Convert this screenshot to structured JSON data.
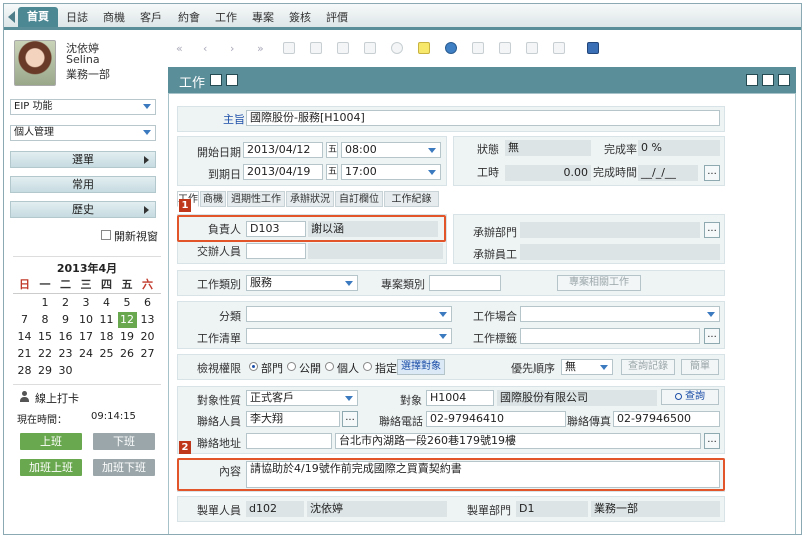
{
  "nav": {
    "tabs": [
      "首頁",
      "日誌",
      "商機",
      "客戶",
      "約會",
      "工作",
      "專案",
      "簽核",
      "評價"
    ],
    "active_index": 0
  },
  "user": {
    "name_zh": "沈依婷",
    "name_en": "Selina",
    "dept": "業務一部"
  },
  "sidebar": {
    "eip_select": "EIP 功能",
    "personal_select": "個人管理",
    "menu_items": [
      "選單",
      "常用",
      "歷史"
    ],
    "new_window_label": "開新視窗"
  },
  "calendar": {
    "title": "2013年4月",
    "weekday_headers": [
      "日",
      "一",
      "二",
      "三",
      "四",
      "五",
      "六"
    ],
    "rows": [
      [
        "",
        "1",
        "2",
        "3",
        "4",
        "5",
        "6"
      ],
      [
        "7",
        "8",
        "9",
        "10",
        "11",
        "12",
        "13"
      ],
      [
        "14",
        "15",
        "16",
        "17",
        "18",
        "19",
        "20"
      ],
      [
        "21",
        "22",
        "23",
        "24",
        "25",
        "26",
        "27"
      ],
      [
        "28",
        "29",
        "30",
        "",
        "",
        "",
        ""
      ]
    ],
    "today": "12",
    "colors": {
      "sunday": "#c0392b",
      "saturday": "#c0392b",
      "today_bg": "#6aa84f"
    }
  },
  "punch": {
    "title": "線上打卡",
    "time_label": "現在時間：",
    "time_value": "09:14:15",
    "btn_in": "上班",
    "btn_out": "下班",
    "btn_ot_in": "加班上班",
    "btn_ot_out": "加班下班"
  },
  "header": {
    "title": "工作"
  },
  "form": {
    "subject_label": "主旨",
    "subject": "國際股份-服務[H1004]",
    "start_label": "開始日期",
    "start_date": "2013/04/12",
    "start_week": "五",
    "start_time": "08:00",
    "end_label": "到期日",
    "end_date": "2013/04/19",
    "end_week": "五",
    "end_time": "17:00",
    "status_label": "狀態",
    "status": "無",
    "completion_label": "完成率",
    "completion": "0 %",
    "hours_label": "工時",
    "hours": "0.00",
    "finish_time_label": "完成時間",
    "finish_time": "__/_/__",
    "tabs": [
      "工作",
      "商機",
      "週期性工作",
      "承辦狀況",
      "自訂欄位",
      "工作紀錄"
    ],
    "owner_label": "負責人",
    "owner_code": "D103",
    "owner_name": "謝以涵",
    "handler_label": "交辦人員",
    "dept_label": "承辦部門",
    "staff_label": "承辦員工",
    "category_label": "工作類別",
    "category": "服務",
    "project_category_label": "專案類別",
    "project_related_btn": "專案相關工作",
    "class_label": "分類",
    "venue_label": "工作場合",
    "list_label": "工作清單",
    "tag_label": "工作標籤",
    "permission_label": "檢視權限",
    "permission_options": [
      "部門",
      "公開",
      "個人",
      "指定"
    ],
    "permission_selected": "部門",
    "choose_target_btn": "選擇對象",
    "priority_label": "優先順序",
    "priority": "無",
    "query_record_btn": "查詢記錄",
    "simple_btn": "簡單",
    "target_type_label": "對象性質",
    "target_type": "正式客戶",
    "target_label": "對象",
    "target_code": "H1004",
    "target_name": "國際股份有限公司",
    "query_btn": "查詢",
    "contact_label": "聯絡人員",
    "contact": "李大翔",
    "phone_label": "聯絡電話",
    "phone": "02-97946410",
    "fax_label": "聯絡傳真",
    "fax": "02-97946500",
    "address_label": "聯絡地址",
    "address": "台北市內湖路一段260巷179號19樓",
    "content_label": "內容",
    "content": "請協助於4/19號作前完成國際之買賣契約書",
    "creator_label": "製單人員",
    "creator_code": "d102",
    "creator_name": "沈依婷",
    "creator_dept_label": "製單部門",
    "creator_dept_code": "D1",
    "creator_dept_name": "業務一部"
  },
  "annotations": {
    "badge1": "1",
    "badge2": "2"
  },
  "colors": {
    "accent": "#5a8e99",
    "highlight": "#e2542a",
    "green_btn": "#6aa84f",
    "gray_btn": "#9aa6a9"
  }
}
